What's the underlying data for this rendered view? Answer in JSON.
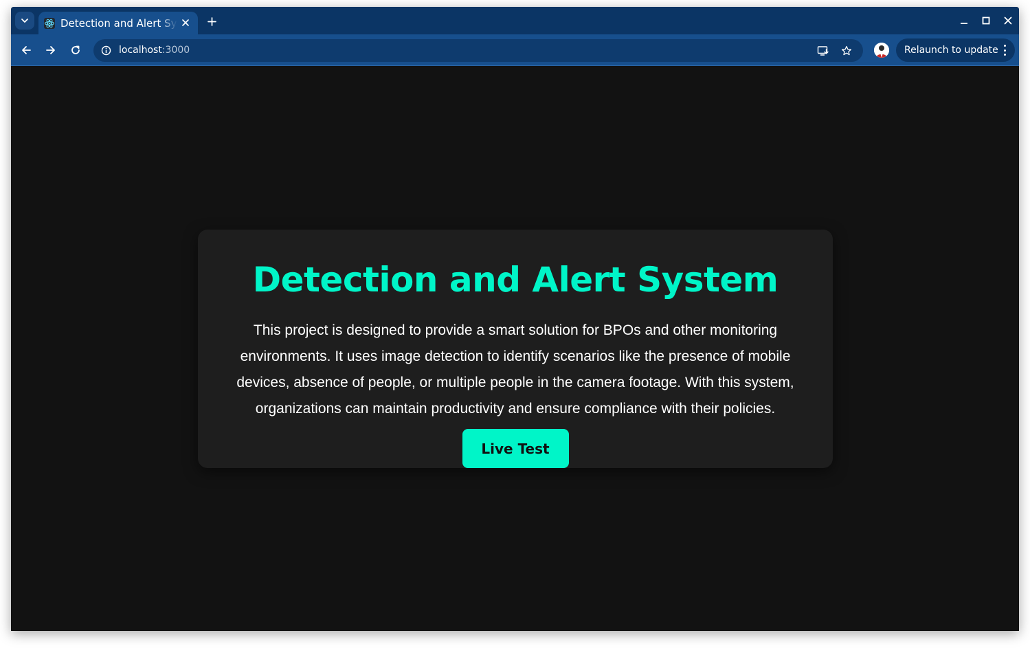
{
  "browser": {
    "tab": {
      "title": "Detection and Alert System",
      "favicon": "react-icon"
    },
    "address_bar": {
      "host": "localhost",
      "port": ":3000"
    },
    "relaunch_label": "Relaunch to update",
    "colors": {
      "frame": "#0b3565",
      "toolbar": "#174f8d"
    }
  },
  "page": {
    "title": "Detection and Alert System",
    "description": "This project is designed to provide a smart solution for BPOs and other monitoring environments. It uses image detection to identify scenarios like the presence of mobile devices, absence of people, or multiple people in the camera footage. With this system, organizations can maintain productivity and ensure compliance with their policies.",
    "cta_label": "Live Test",
    "colors": {
      "accent": "#00f5c8",
      "background": "#121212",
      "card": "#1e1e1e"
    }
  }
}
